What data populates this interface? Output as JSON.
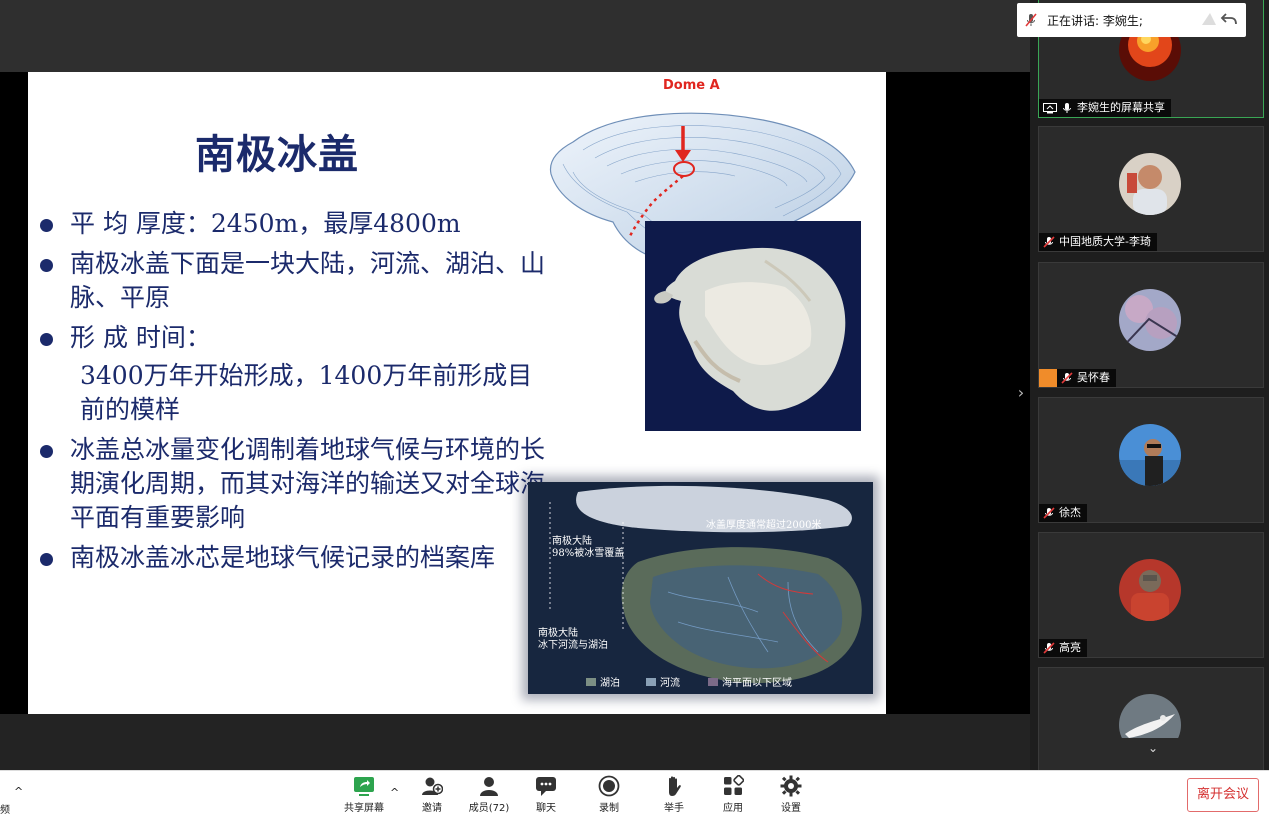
{
  "slide": {
    "title": "南极冰盖",
    "bullets": [
      {
        "text": "平 均 厚度：2450m，最厚4800m"
      },
      {
        "text": "南极冰盖下面是一块大陆，河流、湖泊、山脉、平原"
      },
      {
        "text": "形 成 时间："
      },
      {
        "text": "3400万年开始形成，1400万年前形成目前的模样",
        "continuation": true
      },
      {
        "text": "冰盖总冰量变化调制着地球气候与环境的长期演化周期，而其对海洋的输送又对全球海平面有重要影响"
      },
      {
        "text": "南极冰盖冰芯是地球气候记录的档案库"
      }
    ],
    "dome_label": "Dome A",
    "bottom_map_labels": {
      "top_caption": "冰盖厚度通常超过2000米",
      "left_top": "南极大陆\n98%被冰雪覆盖",
      "left_bottom": "南极大陆\n冰下河流与湖泊",
      "legend_lake": "湖泊",
      "legend_river": "河流",
      "legend_below_sea": "海平面以下区域"
    }
  },
  "speaking": {
    "text": "正在讲话: 李婉生;"
  },
  "participants": [
    {
      "name": "李婉生的屏幕共享",
      "icon": "screen-share-icon",
      "muted": false,
      "active": true
    },
    {
      "name": "中国地质大学-李琦",
      "icon": "mic-muted-icon",
      "muted": true
    },
    {
      "name": "吴怀春",
      "icon": "mic-muted-icon",
      "muted": true
    },
    {
      "name": "徐杰",
      "icon": "mic-muted-icon",
      "muted": true
    },
    {
      "name": "高亮",
      "icon": "mic-muted-icon",
      "muted": true
    }
  ],
  "toolbar": {
    "left_fragment": "频",
    "share_label": "共享屏幕",
    "invite_label": "邀请",
    "members_label": "成员(72)",
    "chat_label": "聊天",
    "record_label": "录制",
    "raise_hand_label": "举手",
    "apps_label": "应用",
    "settings_label": "设置",
    "leave_label": "离开会议"
  },
  "colors": {
    "slide_text": "#1b2a6b",
    "accent_green": "#3aa655",
    "leave_red": "#d43030",
    "dome_red": "#e0261f"
  }
}
